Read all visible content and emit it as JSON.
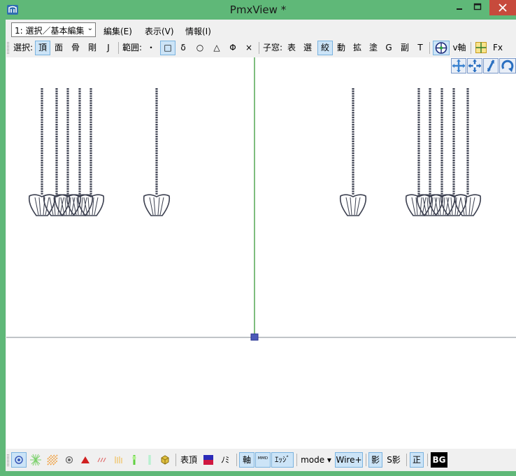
{
  "window": {
    "title": "PmxView *",
    "controls": {
      "minimize": "—",
      "maximize": "☐",
      "close": "✕"
    }
  },
  "menubar": {
    "mode_select": "1: 選択／基本編集",
    "items": [
      "編集(E)",
      "表示(V)",
      "情報(I)"
    ]
  },
  "toolbar": {
    "select_label": "選択:",
    "select_items": [
      "頂",
      "面",
      "骨",
      "剛",
      "J"
    ],
    "range_label": "範囲:",
    "range_items": [
      "・",
      "□",
      "δ",
      "○",
      "△",
      "Φ",
      "×"
    ],
    "subwin_label": "子窓:",
    "subwin_items": [
      "表",
      "選",
      "絞",
      "動",
      "拡",
      "塗",
      "G",
      "副",
      "T"
    ],
    "axis_label": "v軸",
    "fx_label": "Fx"
  },
  "bottombar": {
    "table_vertex": "表頂",
    "no_label": "ﾉﾐ",
    "axis_label": "軸",
    "mmd_label": "ᴹᴹᴰ",
    "edge_label": "ｴｯｼﾞ",
    "mode_label": "mode ▾",
    "wire_label": "Wire+",
    "shadow_label": "影",
    "sshadow_label": "S影",
    "ortho_label": "正",
    "bg_label": "BG"
  },
  "colors": {
    "titlebar": "#5fb878",
    "close_button": "#c74a3c",
    "active_toggle": "#cce4f7",
    "axis_green": "#3a9a3a",
    "mesh": "#3c4050",
    "origin_marker": "#4a5ab8"
  },
  "icons": {
    "app": "app-icon",
    "nav": [
      "move-xy-icon",
      "move-xz-icon",
      "zoom-icon",
      "rotate-icon"
    ],
    "bottom": [
      "vertex-point-icon",
      "burst-icon",
      "dither-icon",
      "circle-point-icon",
      "red-triangle-icon",
      "slash-pattern-icon",
      "tick-pattern-icon",
      "green-rod-icon",
      "green-bar-icon",
      "cube-icon"
    ]
  }
}
